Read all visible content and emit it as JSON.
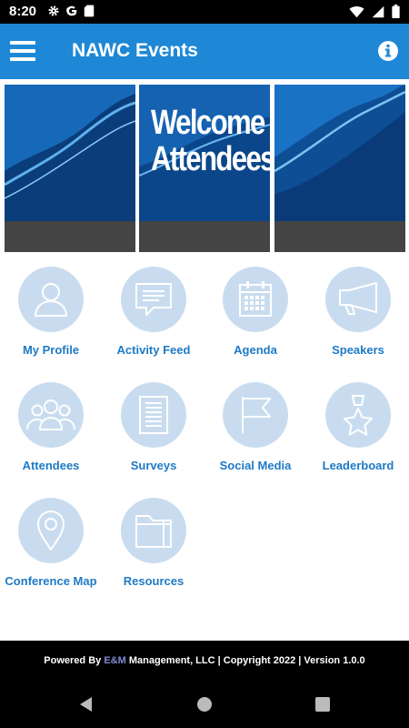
{
  "status_bar": {
    "time": "8:20",
    "left_icons": [
      "settings-icon",
      "google-icon",
      "sd-card-icon"
    ],
    "right_icons": [
      "wifi-icon",
      "signal-icon",
      "battery-icon"
    ]
  },
  "app_bar": {
    "title": "NAWC Events",
    "color": "#1e88d6"
  },
  "banner": {
    "line1": "Welcome",
    "line2": "Attendees"
  },
  "menu_items": [
    {
      "label": "My Profile",
      "icon": "profile-icon"
    },
    {
      "label": "Activity Feed",
      "icon": "chat-bubble-icon"
    },
    {
      "label": "Agenda",
      "icon": "calendar-icon"
    },
    {
      "label": "Speakers",
      "icon": "megaphone-icon"
    },
    {
      "label": "Attendees",
      "icon": "group-icon"
    },
    {
      "label": "Surveys",
      "icon": "document-icon"
    },
    {
      "label": "Social Media",
      "icon": "flag-icon"
    },
    {
      "label": "Leaderboard",
      "icon": "medal-star-icon"
    },
    {
      "label": "Conference Map",
      "icon": "map-pin-icon"
    },
    {
      "label": "Resources",
      "icon": "folder-icon"
    }
  ],
  "footer": {
    "prefix": "Powered By ",
    "brand": "E&M",
    "suffix": " Management, LLC | Copyright 2022 | Version 1.0.0"
  },
  "nav_bar": {
    "buttons": [
      "back-icon",
      "home-icon",
      "recents-icon"
    ]
  }
}
